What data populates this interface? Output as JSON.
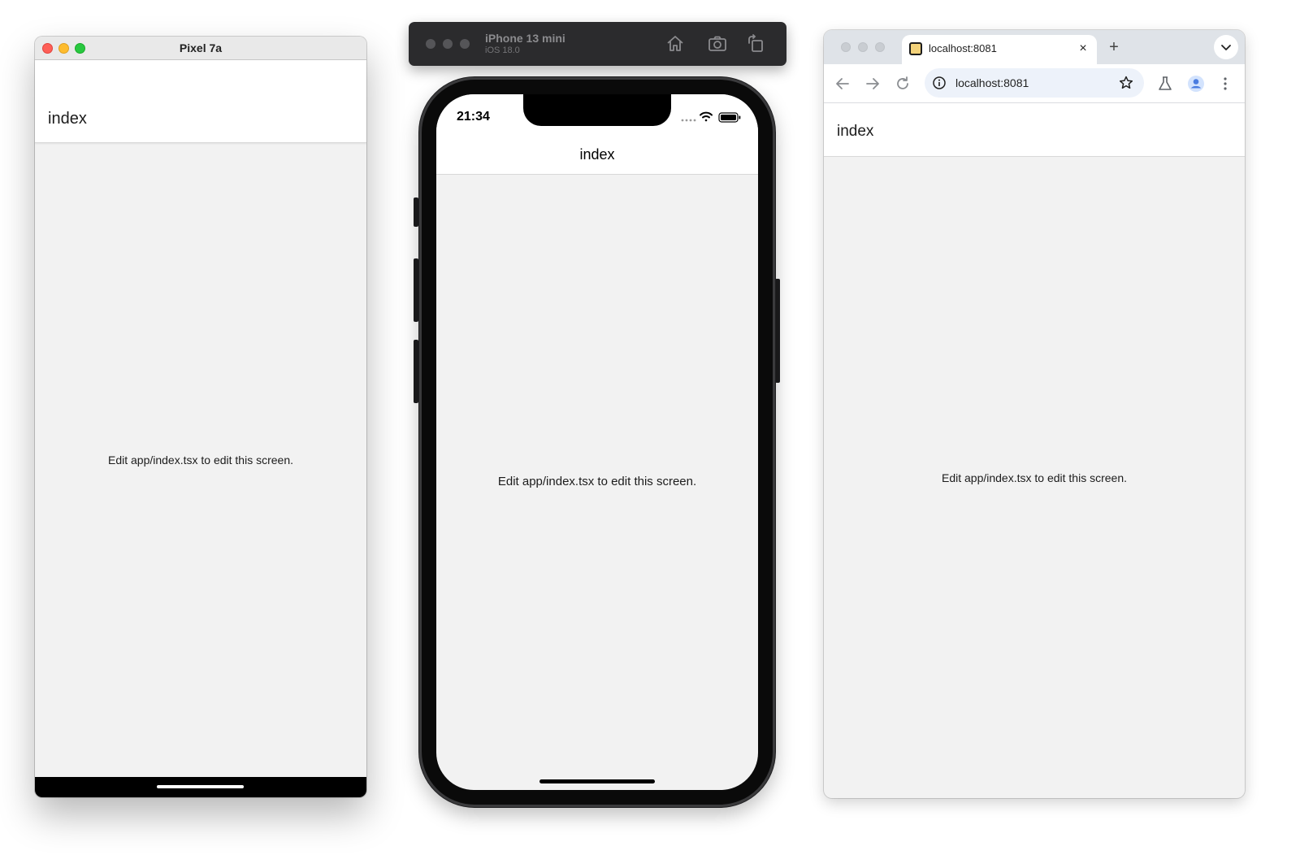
{
  "android": {
    "window_title": "Pixel 7a",
    "header_title": "index",
    "body_text": "Edit app/index.tsx to edit this screen."
  },
  "ios_simulator": {
    "device_name": "iPhone 13 mini",
    "os_version": "iOS 18.0",
    "status_time": "21:34",
    "header_title": "index",
    "body_text": "Edit app/index.tsx to edit this screen.",
    "icons": [
      "home-icon",
      "screenshot-icon",
      "rotate-icon",
      "signal-dots-icon",
      "wifi-icon",
      "battery-icon"
    ]
  },
  "chrome": {
    "tab_title": "localhost:8081",
    "tab_close": "×",
    "new_tab": "+",
    "address": "localhost:8081",
    "header_title": "index",
    "body_text": "Edit app/index.tsx to edit this screen.",
    "icons": [
      "back-icon",
      "forward-icon",
      "reload-icon",
      "info-icon",
      "star-icon",
      "labs-icon",
      "profile-icon",
      "menu-icon",
      "tab-search-icon"
    ]
  },
  "colors": {
    "screen_bg": "#f2f2f2",
    "header_bg": "#ffffff",
    "omnibox_bg": "#edf2fa",
    "tabstrip_bg": "#dfe3e8",
    "simulator_toolbar_bg": "#2b2b2d"
  }
}
